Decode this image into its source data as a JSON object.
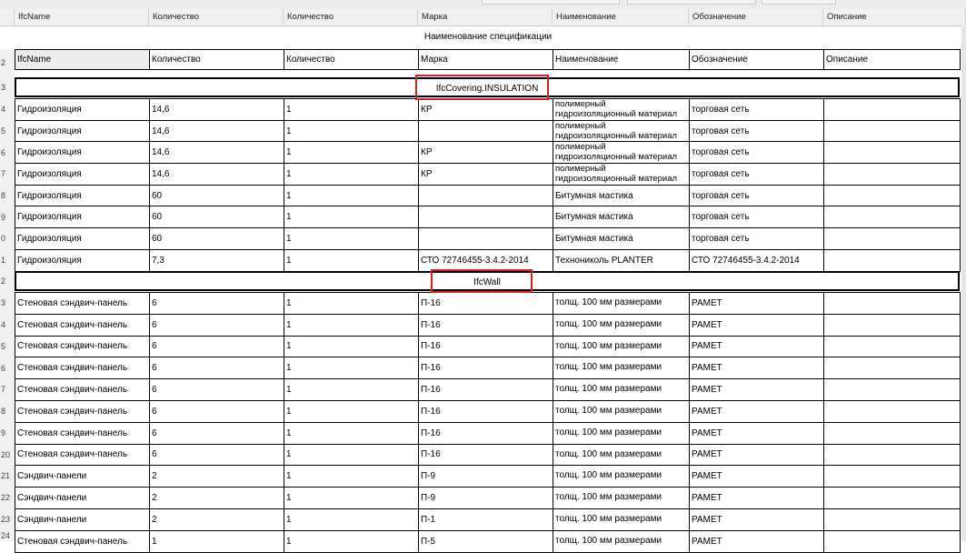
{
  "columns": [
    "IfcName",
    "Количество",
    "Количество",
    "Марка",
    "Наименование",
    "Обозначение",
    "Описание"
  ],
  "spec_title": "Наименование спецификации",
  "header_row": [
    "IfcName",
    "Количество",
    "Количество",
    "Марка",
    "Наименование",
    "Обозначение",
    "Описание"
  ],
  "groups": {
    "covering": "IfcCovering.INSULATION",
    "wall": "IfcWall"
  },
  "row_numbers": [
    "2",
    "3",
    "4",
    "5",
    "6",
    "7",
    "8",
    "9",
    "0",
    "1",
    "2",
    "3",
    "4",
    "5",
    "6",
    "7",
    "8",
    "9",
    "20",
    "21",
    "22",
    "23",
    "24"
  ],
  "rows_covering": [
    {
      "c0": "Гидроизоляция",
      "c1": "14,6",
      "c2": "1",
      "c3": "КР",
      "c4a": "полимерный",
      "c4b": "гидроизоляционный материал",
      "c5": "торговая сеть",
      "c6": ""
    },
    {
      "c0": "Гидроизоляция",
      "c1": "14,6",
      "c2": "1",
      "c3": "",
      "c4a": "полимерный",
      "c4b": "гидроизоляционный материал",
      "c5": "торговая сеть",
      "c6": ""
    },
    {
      "c0": "Гидроизоляция",
      "c1": "14,6",
      "c2": "1",
      "c3": "КР",
      "c4a": "полимерный",
      "c4b": "гидроизоляционный материал",
      "c5": "торговая сеть",
      "c6": ""
    },
    {
      "c0": "Гидроизоляция",
      "c1": "14,6",
      "c2": "1",
      "c3": "КР",
      "c4a": "полимерный",
      "c4b": "гидроизоляционный материал",
      "c5": "торговая сеть",
      "c6": ""
    },
    {
      "c0": "Гидроизоляция",
      "c1": "60",
      "c2": "1",
      "c3": "",
      "c4": "Битумная мастика",
      "c5": "торговая сеть",
      "c6": ""
    },
    {
      "c0": "Гидроизоляция",
      "c1": "60",
      "c2": "1",
      "c3": "",
      "c4": "Битумная мастика",
      "c5": "торговая сеть",
      "c6": ""
    },
    {
      "c0": "Гидроизоляция",
      "c1": "60",
      "c2": "1",
      "c3": "",
      "c4": "Битумная мастика",
      "c5": "торговая сеть",
      "c6": ""
    },
    {
      "c0": "Гидроизоляция",
      "c1": "7,3",
      "c2": "1",
      "c3": "СТО 72746455-3.4.2-2014",
      "c4": "Технониколь PLANTER",
      "c5": "СТО 72746455-3.4.2-2014",
      "c6": ""
    }
  ],
  "rows_wall": [
    {
      "c0": "Стеновая сэндвич-панель",
      "c1": "6",
      "c2": "1",
      "c3": "П-16",
      "c4": "толщ. 100 мм размерами",
      "c5": "РАМЕТ",
      "c6": ""
    },
    {
      "c0": "Стеновая сэндвич-панель",
      "c1": "6",
      "c2": "1",
      "c3": "П-16",
      "c4": "толщ. 100 мм размерами",
      "c5": "РАМЕТ",
      "c6": ""
    },
    {
      "c0": "Стеновая сэндвич-панель",
      "c1": "6",
      "c2": "1",
      "c3": "П-16",
      "c4": "толщ. 100 мм размерами",
      "c5": "РАМЕТ",
      "c6": ""
    },
    {
      "c0": "Стеновая сэндвич-панель",
      "c1": "6",
      "c2": "1",
      "c3": "П-16",
      "c4": "толщ. 100 мм размерами",
      "c5": "РАМЕТ",
      "c6": ""
    },
    {
      "c0": "Стеновая сэндвич-панель",
      "c1": "6",
      "c2": "1",
      "c3": "П-16",
      "c4": "толщ. 100 мм размерами",
      "c5": "РАМЕТ",
      "c6": ""
    },
    {
      "c0": "Стеновая сэндвич-панель",
      "c1": "6",
      "c2": "1",
      "c3": "П-16",
      "c4": "толщ. 100 мм размерами",
      "c5": "РАМЕТ",
      "c6": ""
    },
    {
      "c0": "Стеновая сэндвич-панель",
      "c1": "6",
      "c2": "1",
      "c3": "П-16",
      "c4": "толщ. 100 мм размерами",
      "c5": "РАМЕТ",
      "c6": ""
    },
    {
      "c0": "Стеновая сэндвич-панель",
      "c1": "6",
      "c2": "1",
      "c3": "П-16",
      "c4": "толщ. 100 мм размерами",
      "c5": "РАМЕТ",
      "c6": ""
    },
    {
      "c0": "Сэндвич-панели",
      "c1": "2",
      "c2": "1",
      "c3": "П-9",
      "c4": "толщ. 100 мм размерами",
      "c5": "РАМЕТ",
      "c6": ""
    },
    {
      "c0": "Сэндвич-панели",
      "c1": "2",
      "c2": "1",
      "c3": "П-9",
      "c4": "толщ. 100 мм размерами",
      "c5": "РАМЕТ",
      "c6": ""
    },
    {
      "c0": "Сэндвич-панели",
      "c1": "2",
      "c2": "1",
      "c3": "П-1",
      "c4": "толщ. 100 мм размерами",
      "c5": "РАМЕТ",
      "c6": ""
    },
    {
      "c0": "Стеновая сэндвич-панель",
      "c1": "1",
      "c2": "1",
      "c3": "П-5",
      "c4": "толщ. 100 мм размерами",
      "c5": "РАМЕТ",
      "c6": ""
    }
  ],
  "colors": {
    "highlight": "#e02020",
    "header_bg": "#f0f0f0",
    "selected_cell": "#ececec"
  }
}
